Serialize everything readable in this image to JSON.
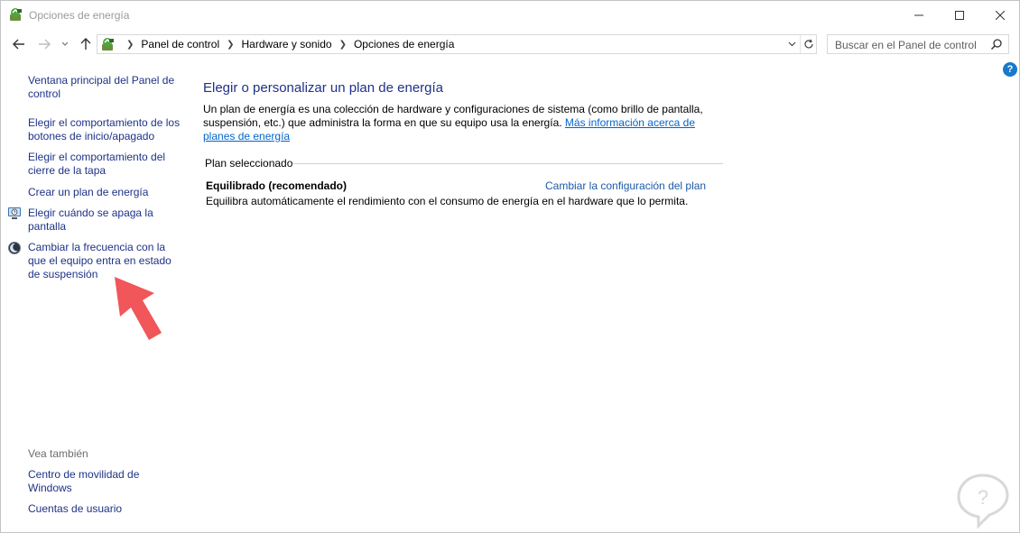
{
  "window": {
    "title": "Opciones de energía"
  },
  "address": {
    "crumbs": [
      "Panel de control",
      "Hardware y sonido",
      "Opciones de energía"
    ]
  },
  "search": {
    "placeholder": "Buscar en el Panel de control"
  },
  "help": {
    "label": "?"
  },
  "sidebar": {
    "items": [
      {
        "label": "Ventana principal del Panel de control"
      },
      {
        "label": "Elegir el comportamiento de los botones de inicio/apagado"
      },
      {
        "label": "Elegir el comportamiento del cierre de la tapa"
      },
      {
        "label": "Crear un plan de energía"
      },
      {
        "label": "Elegir cuándo se apaga la pantalla",
        "icon": "monitor-clock-icon"
      },
      {
        "label": "Cambiar la frecuencia con la que el equipo entra en estado de suspensión",
        "icon": "sleep-moon-icon"
      }
    ],
    "see_also": {
      "heading": "Vea también",
      "items": [
        {
          "label": "Centro de movilidad de Windows"
        },
        {
          "label": "Cuentas de usuario"
        }
      ]
    }
  },
  "main": {
    "title": "Elegir o personalizar un plan de energía",
    "intro_text": "Un plan de energía es una colección de hardware y configuraciones de sistema (como brillo de pantalla, suspensión, etc.) que administra la forma en que su equipo usa la energía.",
    "intro_link": "Más información acerca de planes de energía",
    "section_heading": "Plan seleccionado",
    "plan": {
      "name": "Equilibrado (recomendado)",
      "change_link": "Cambiar la configuración del plan",
      "description": "Equilibra automáticamente el rendimiento con el consumo de energía en el hardware que lo permita."
    }
  },
  "colors": {
    "link": "#1e3287",
    "arrow": "#f0565a",
    "help": "#1979ca"
  }
}
